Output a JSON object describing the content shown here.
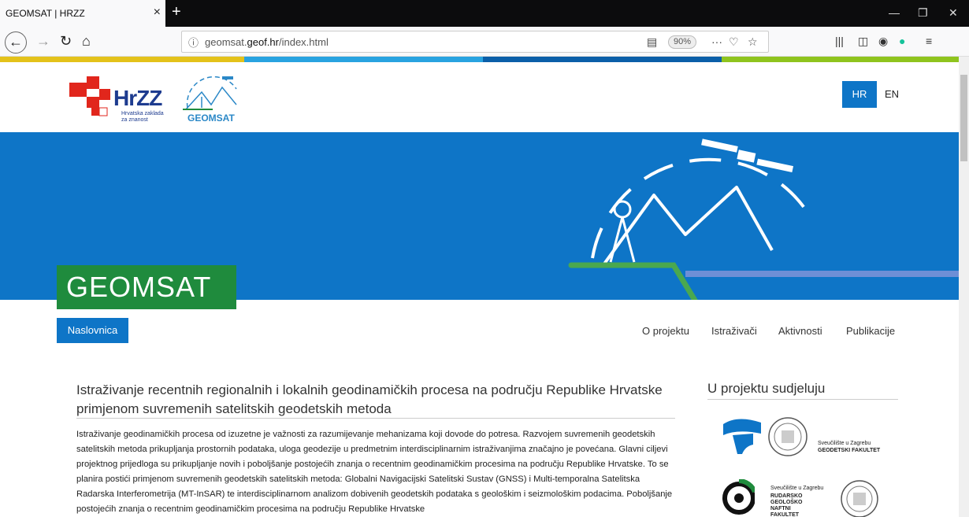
{
  "browser": {
    "tab_title": "GEOMSAT | HRZZ",
    "url_prefix": "geomsat.",
    "url_domain": "geof.hr",
    "url_path": "/index.html",
    "zoom": "90%"
  },
  "header": {
    "hrzz_logo": "HrZZ",
    "hrzz_sub": "Hrvatska zaklada za znanost",
    "geomsat_logo": "GEOMSAT",
    "lang_hr": "HR",
    "lang_en": "EN"
  },
  "hero": {
    "title": "GEOMSAT"
  },
  "nav": {
    "home": "Naslovnica",
    "about": "O projektu",
    "researchers": "Istraživači",
    "activities": "Aktivnosti",
    "publications": "Publikacije"
  },
  "article": {
    "title": "Istraživanje recentnih regionalnih i lokalnih geodinamičkih procesa na području Republike Hrvatske primjenom suvremenih satelitskih geodetskih metoda",
    "body": "Istraživanje geodinamičkih procesa od izuzetne je važnosti za razumijevanje mehanizama koji dovode do potresa. Razvojem suvremenih geodetskih satelitskih metoda prikupljanja prostornih podataka, uloga geodezije u predmetnim interdisciplinarnim istraživanjima značajno je povećana. Glavni ciljevi projektnog prijedloga su prikupljanje novih i poboljšanje postojećih znanja o recentnim geodinamičkim procesima na području Republike Hrvatske. To se planira postići primjenom suvremenih geodetskih satelitskih metoda: Globalni Navigacijski Satelitski Sustav (GNSS) i Multi-temporalna Satelitska Radarska Interferometrija (MT-InSAR) te interdisciplinarnom analizom dobivenih geodetskih podataka s geološkim i seizmološkim podacima. Poboljšanje postojećih znanja o recentnim geodinamičkim procesima na području Republike Hrvatske"
  },
  "sidebar": {
    "title": "U projektu sudjeluju",
    "partner1": "Sveučilište u Zagrebu",
    "partner1_b": "GEODETSKI FAKULTET",
    "partner2": "Sveučilište u Zagrebu",
    "partner2_b": "RUDARSKO GEOLOŠKO NAFTNI FAKULTET"
  },
  "colors": {
    "blue": "#0e75c7",
    "green": "#1f8b3d",
    "stripe": [
      "#e4c21a",
      "#29a3e0",
      "#0b5fa8",
      "#8fc41e"
    ]
  }
}
